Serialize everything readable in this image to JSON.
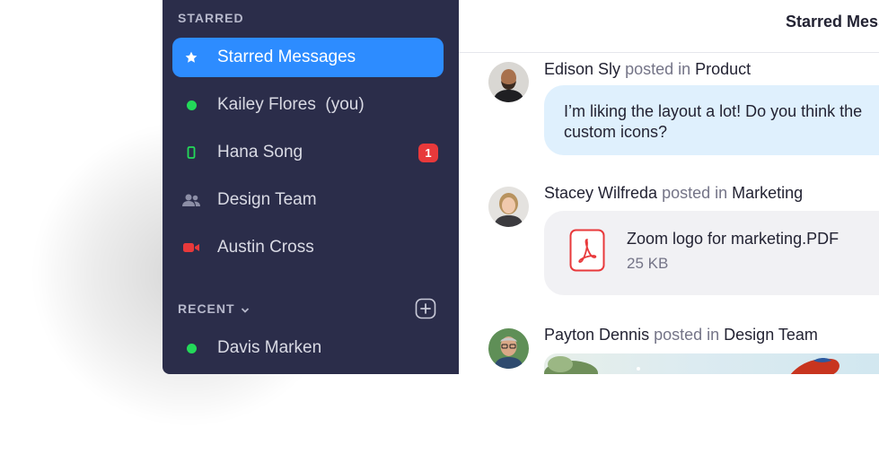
{
  "sidebar": {
    "starred_heading": "STARRED",
    "recent_heading": "RECENT",
    "items": [
      {
        "label": "Starred Messages",
        "icon": "star-icon"
      },
      {
        "label": "Kailey Flores  (you)",
        "icon": "online-dot-icon"
      },
      {
        "label": "Hana Song",
        "icon": "mobile-icon",
        "badge": "1"
      },
      {
        "label": "Design Team",
        "icon": "group-icon"
      },
      {
        "label": "Austin Cross",
        "icon": "video-camera-icon"
      }
    ],
    "recent_items": [
      {
        "label": "Davis Marken",
        "icon": "online-dot-icon"
      }
    ]
  },
  "main": {
    "title": "Starred Messages",
    "posted_in": "posted in",
    "posts": [
      {
        "author": "Edison Sly",
        "channel": "Product",
        "message": "I’m liking the layout a lot! Do you think the\ncustom icons?"
      },
      {
        "author": "Stacey Wilfreda",
        "channel": "Marketing",
        "file_name": "Zoom logo for marketing.PDF",
        "file_size": "25 KB"
      },
      {
        "author": "Payton Dennis",
        "channel": "Design Team"
      }
    ]
  },
  "colors": {
    "sidebar_bg": "#2b2d4a",
    "accent": "#2d8cff",
    "online": "#23d959",
    "badge": "#e8393b",
    "bubble": "#dff0fd",
    "pdf_red": "#e8393b"
  }
}
